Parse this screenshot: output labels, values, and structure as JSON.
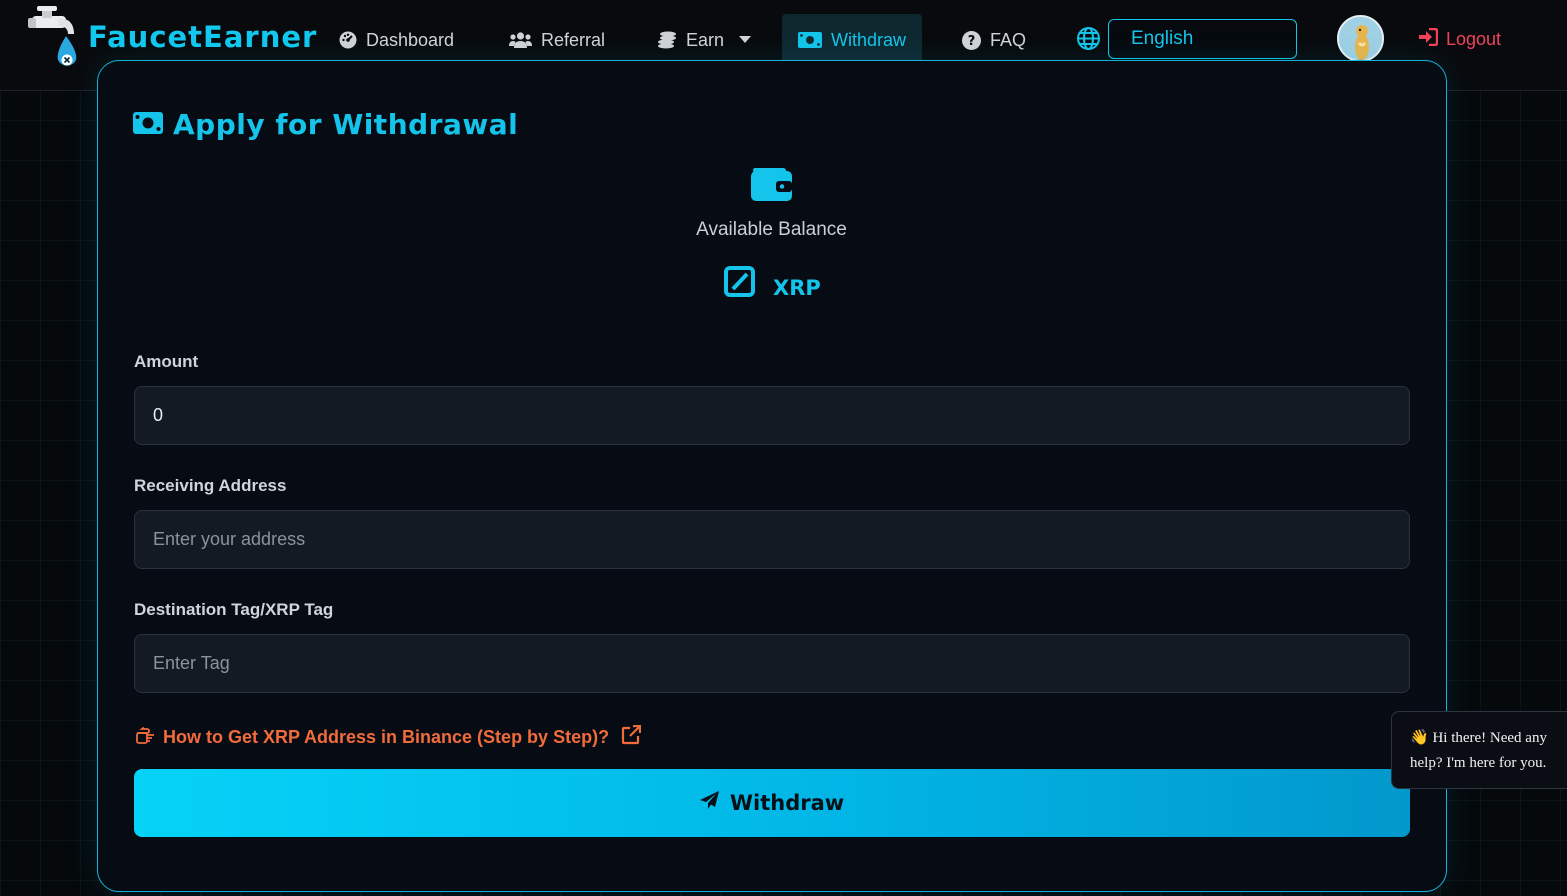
{
  "brand": {
    "name": "FaucetEarner"
  },
  "nav": {
    "items": [
      {
        "label": "Dashboard",
        "icon": "gauge-icon"
      },
      {
        "label": "Referral",
        "icon": "users-icon"
      },
      {
        "label": "Earn",
        "icon": "coins-icon"
      },
      {
        "label": "Withdraw",
        "icon": "money-bill-icon",
        "active": true
      },
      {
        "label": "FAQ",
        "icon": "question-circle-icon"
      }
    ],
    "language": "English",
    "logout": "Logout"
  },
  "withdraw": {
    "title": "Apply for Withdrawal",
    "balance_label": "Available Balance",
    "coin": "XRP",
    "amount": {
      "label": "Amount",
      "value": "0"
    },
    "address": {
      "label": "Receiving Address",
      "placeholder": "Enter your address"
    },
    "tag": {
      "label": "Destination Tag/XRP Tag",
      "placeholder": "Enter Tag"
    },
    "help_link": "How to Get XRP Address in Binance (Step by Step)?",
    "submit": "Withdraw"
  },
  "chat": {
    "line1": "Hi there! Need any",
    "line2": "help? I'm here for you."
  },
  "colors": {
    "accent": "#14c4ea",
    "logout": "#f0435a",
    "link": "#f26b3a"
  }
}
